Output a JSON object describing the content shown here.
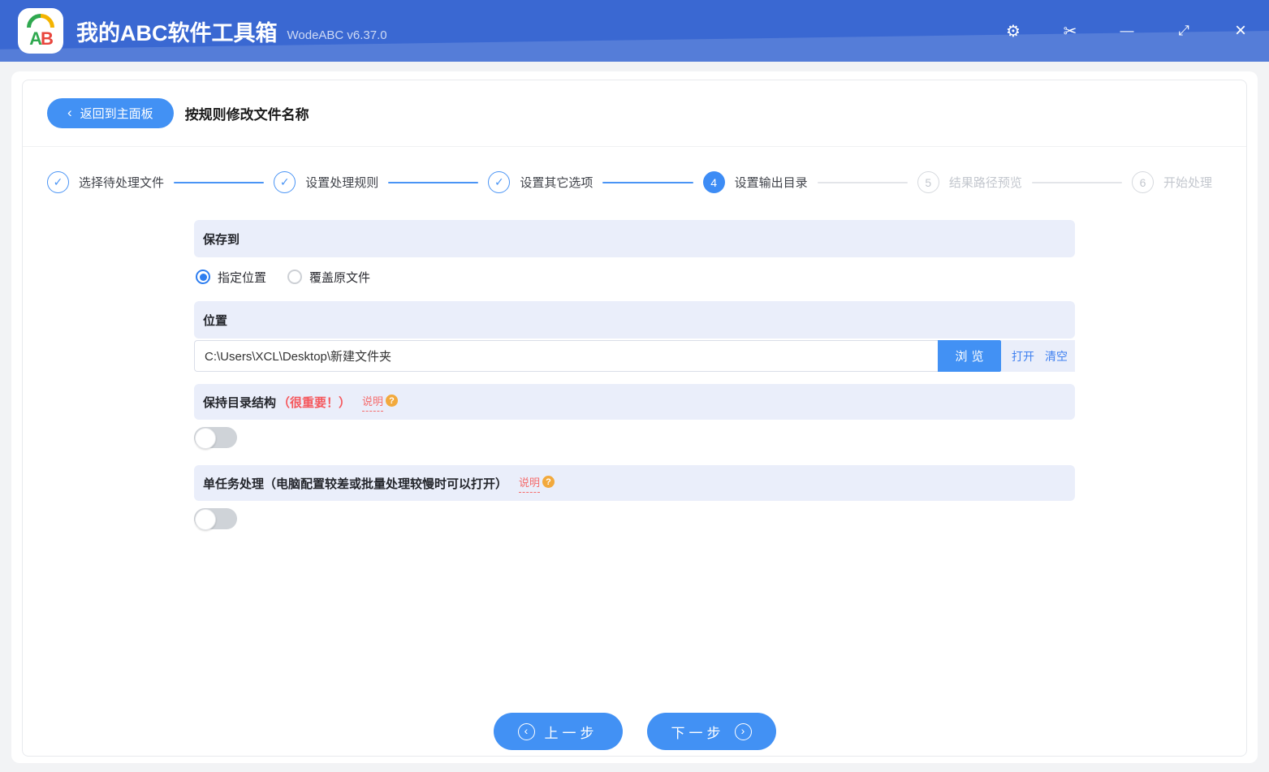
{
  "titlebar": {
    "logo_letter_a": "A",
    "logo_letter_b": "B",
    "app_title": "我的ABC软件工具箱",
    "version": "WodeABC v6.37.0",
    "icons": {
      "settings": "⚙",
      "cut": "✂",
      "minimize": "—",
      "maximize": "⤢",
      "close": "×"
    }
  },
  "header": {
    "back_icon": "‹",
    "back_label": "返回到主面板",
    "page_title": "按规则修改文件名称"
  },
  "stepper": {
    "steps": [
      {
        "mark": "✓",
        "label": "选择待处理文件",
        "state": "done"
      },
      {
        "mark": "✓",
        "label": "设置处理规则",
        "state": "done"
      },
      {
        "mark": "✓",
        "label": "设置其它选项",
        "state": "done"
      },
      {
        "mark": "4",
        "label": "设置输出目录",
        "state": "current"
      },
      {
        "mark": "5",
        "label": "结果路径预览",
        "state": "upcoming"
      },
      {
        "mark": "6",
        "label": "开始处理",
        "state": "upcoming"
      }
    ]
  },
  "save_to": {
    "title": "保存到",
    "options": [
      {
        "label": "指定位置",
        "selected": true
      },
      {
        "label": "覆盖原文件",
        "selected": false
      }
    ]
  },
  "location": {
    "title": "位置",
    "path": "C:\\Users\\XCL\\Desktop\\新建文件夹",
    "browse_label": "浏览",
    "open_label": "打开",
    "clear_label": "清空"
  },
  "keep_structure": {
    "title": "保持目录结构",
    "important": "（很重要！）",
    "help_label": "说明",
    "help_mark": "?",
    "enabled": false
  },
  "single_task": {
    "title": "单任务处理（电脑配置较差或批量处理较慢时可以打开）",
    "help_label": "说明",
    "help_mark": "?",
    "enabled": false
  },
  "footer": {
    "prev_icon": "‹",
    "prev_label": "上一步",
    "next_icon": "›",
    "next_label": "下一步"
  },
  "colors": {
    "titlebar": "#3a68d2",
    "accent": "#4291f4",
    "section_bg": "#eaeefa",
    "danger": "#f5575c",
    "link": "#3f80f0",
    "warning": "#f2a93c"
  }
}
